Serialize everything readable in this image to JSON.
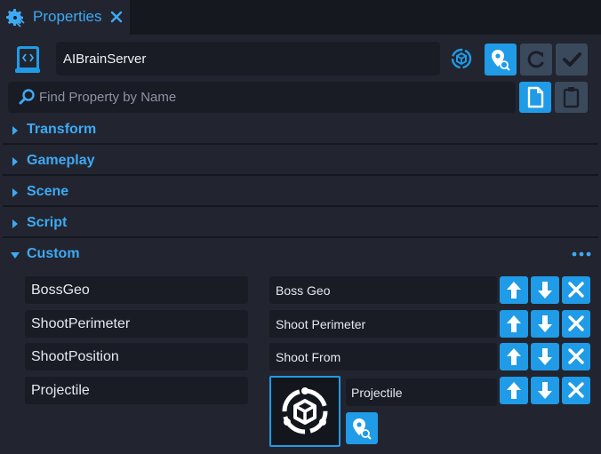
{
  "tab": {
    "title": "Properties",
    "close_icon": "close-icon",
    "gear_icon": "gear-icon"
  },
  "header": {
    "object_name": "AIBrainServer",
    "script_icon": "script-icon",
    "network_icon": "network-context-icon"
  },
  "search": {
    "placeholder": "Find Property by Name",
    "value": ""
  },
  "sections": [
    {
      "label": "Transform",
      "expanded": false
    },
    {
      "label": "Gameplay",
      "expanded": false
    },
    {
      "label": "Scene",
      "expanded": false
    },
    {
      "label": "Script",
      "expanded": false
    },
    {
      "label": "Custom",
      "expanded": true
    }
  ],
  "custom_properties": [
    {
      "name": "BossGeo",
      "value": "Boss Geo"
    },
    {
      "name": "ShootPerimeter",
      "value": "Shoot Perimeter"
    },
    {
      "name": "ShootPosition",
      "value": "Shoot From"
    },
    {
      "name": "Projectile",
      "value": "Projectile",
      "is_asset": true
    }
  ],
  "colors": {
    "accent": "#1f9be7",
    "label": "#3ea9f5",
    "panel": "#22252f",
    "field": "#191b25"
  }
}
